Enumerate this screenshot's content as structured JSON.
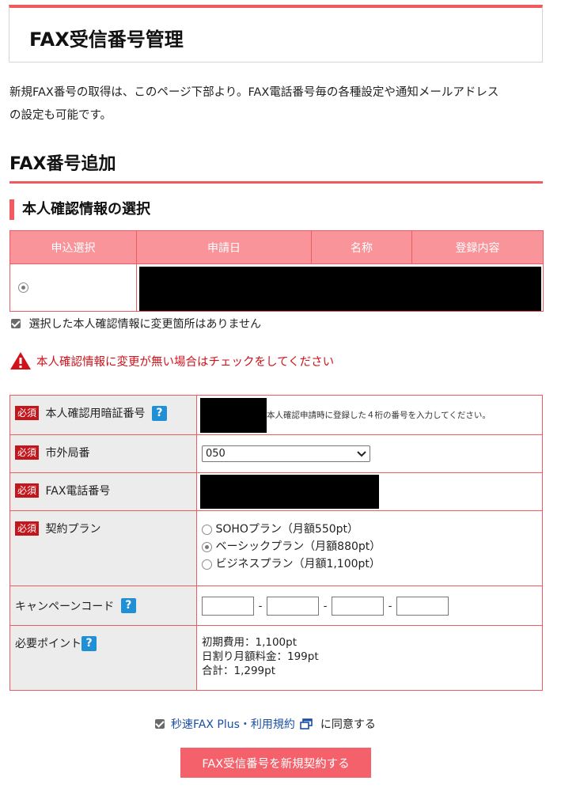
{
  "page": {
    "title": "FAX受信番号管理",
    "intro_line1": "新規FAX番号の取得は、このページ下部より。FAX電話番号毎の各種設定や通知メールアドレス",
    "intro_line2": "の設定も可能です。"
  },
  "section": {
    "title": "FAX番号追加",
    "subtitle": "本人確認情報の選択"
  },
  "id_table": {
    "columns": [
      "申込選択",
      "申請日",
      "名称",
      "登録内容"
    ]
  },
  "confirm": {
    "label": "選択した本人確認情報に変更箇所はありません"
  },
  "warning": {
    "text": "本人確認情報に変更が無い場合はチェックをしてください"
  },
  "form": {
    "required_badge": "必須",
    "pin_label": "本人確認用暗証番号",
    "pin_hint": "本人確認申請時に登録した４桁の番号を入力してください。",
    "prefix_label": "市外局番",
    "prefix_value": "050",
    "fax_label": "FAX電話番号",
    "plan_label": "契約プラン",
    "plans": [
      "SOHOプラン（月額550pt）",
      "ベーシックプラン（月額880pt）",
      "ビジネスプラン（月額1,100pt）"
    ],
    "campaign_label": "キャンペーンコード",
    "points_label": "必要ポイント",
    "points_initial": "初期費用：1,100pt",
    "points_monthly": "日割り月額料金：199pt",
    "points_total": "合計：1,299pt",
    "help_glyph": "?",
    "dash": "-"
  },
  "agreement": {
    "link_text": "秒速FAX Plus・利用規約",
    "suffix": "に同意する"
  },
  "submit": {
    "label": "FAX受信番号を新規契約する"
  },
  "colors": {
    "accent": "#f15a5f",
    "header_bg": "#f8949a",
    "required": "#c4151c",
    "warning": "#d0121b",
    "help_icon": "#1f8fd6",
    "button": "#f5616a"
  }
}
